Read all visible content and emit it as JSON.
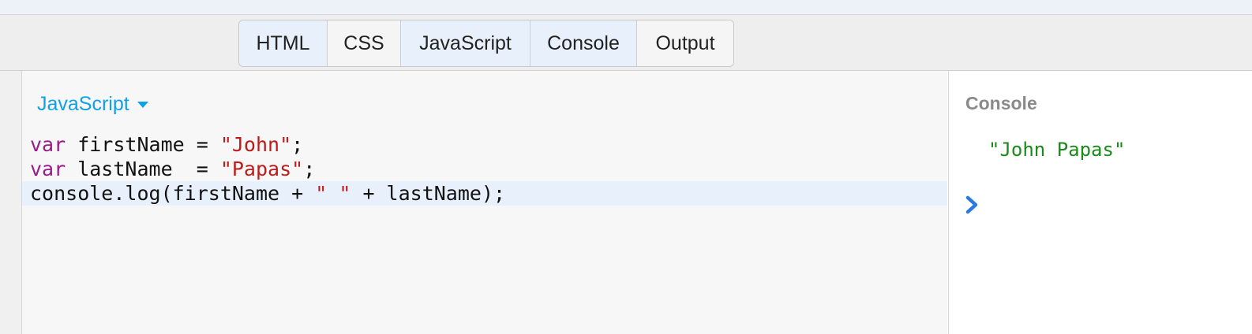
{
  "tabs": [
    {
      "label": "HTML",
      "state": "active"
    },
    {
      "label": "CSS",
      "state": "inactive"
    },
    {
      "label": "JavaScript",
      "state": "active"
    },
    {
      "label": "Console",
      "state": "active"
    },
    {
      "label": "Output",
      "state": "inactive"
    }
  ],
  "editor": {
    "language_label": "JavaScript",
    "language_icon": "caret-down-icon",
    "lines": [
      [
        {
          "t": "kw",
          "v": "var"
        },
        {
          "t": "plain",
          "v": " firstName = "
        },
        {
          "t": "str",
          "v": "\"John\""
        },
        {
          "t": "plain",
          "v": ";"
        }
      ],
      [
        {
          "t": "kw",
          "v": "var"
        },
        {
          "t": "plain",
          "v": " lastName  = "
        },
        {
          "t": "str",
          "v": "\"Papas\""
        },
        {
          "t": "plain",
          "v": ";"
        }
      ],
      [
        {
          "t": "plain",
          "v": "console.log(firstName + "
        },
        {
          "t": "str",
          "v": "\" \""
        },
        {
          "t": "plain",
          "v": " + lastName);"
        }
      ]
    ],
    "active_line": 2
  },
  "console": {
    "title": "Console",
    "output": "\"John Papas\"",
    "prompt_icon": "chevron-right-icon"
  },
  "colors": {
    "accent": "#10a0e8",
    "keyword": "#9b1a8c",
    "string": "#c01a1a",
    "console_output": "#1a8a1a",
    "prompt": "#2a7ae2"
  }
}
